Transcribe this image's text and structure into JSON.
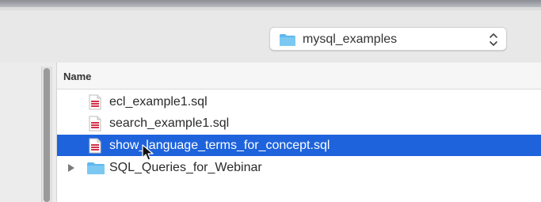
{
  "location": {
    "folder_name": "mysql_examples",
    "icon": "folder-icon",
    "control_icon": "up-down-chevron-icon"
  },
  "list": {
    "column_header": "Name",
    "items": [
      {
        "label": "ecl_example1.sql",
        "icon": "sql-file-icon",
        "selected": false,
        "kind": "file"
      },
      {
        "label": "search_example1.sql",
        "icon": "sql-file-icon",
        "selected": false,
        "kind": "file"
      },
      {
        "label": "show_language_terms_for_concept.sql",
        "icon": "sql-file-icon",
        "selected": true,
        "kind": "file"
      },
      {
        "label": "SQL_Queries_for_Webinar",
        "icon": "folder-icon",
        "selected": false,
        "kind": "folder"
      }
    ]
  },
  "colors": {
    "selection": "#1e63dc",
    "folder": "#5fb8ec",
    "sql_file_accent": "#d3314a"
  }
}
